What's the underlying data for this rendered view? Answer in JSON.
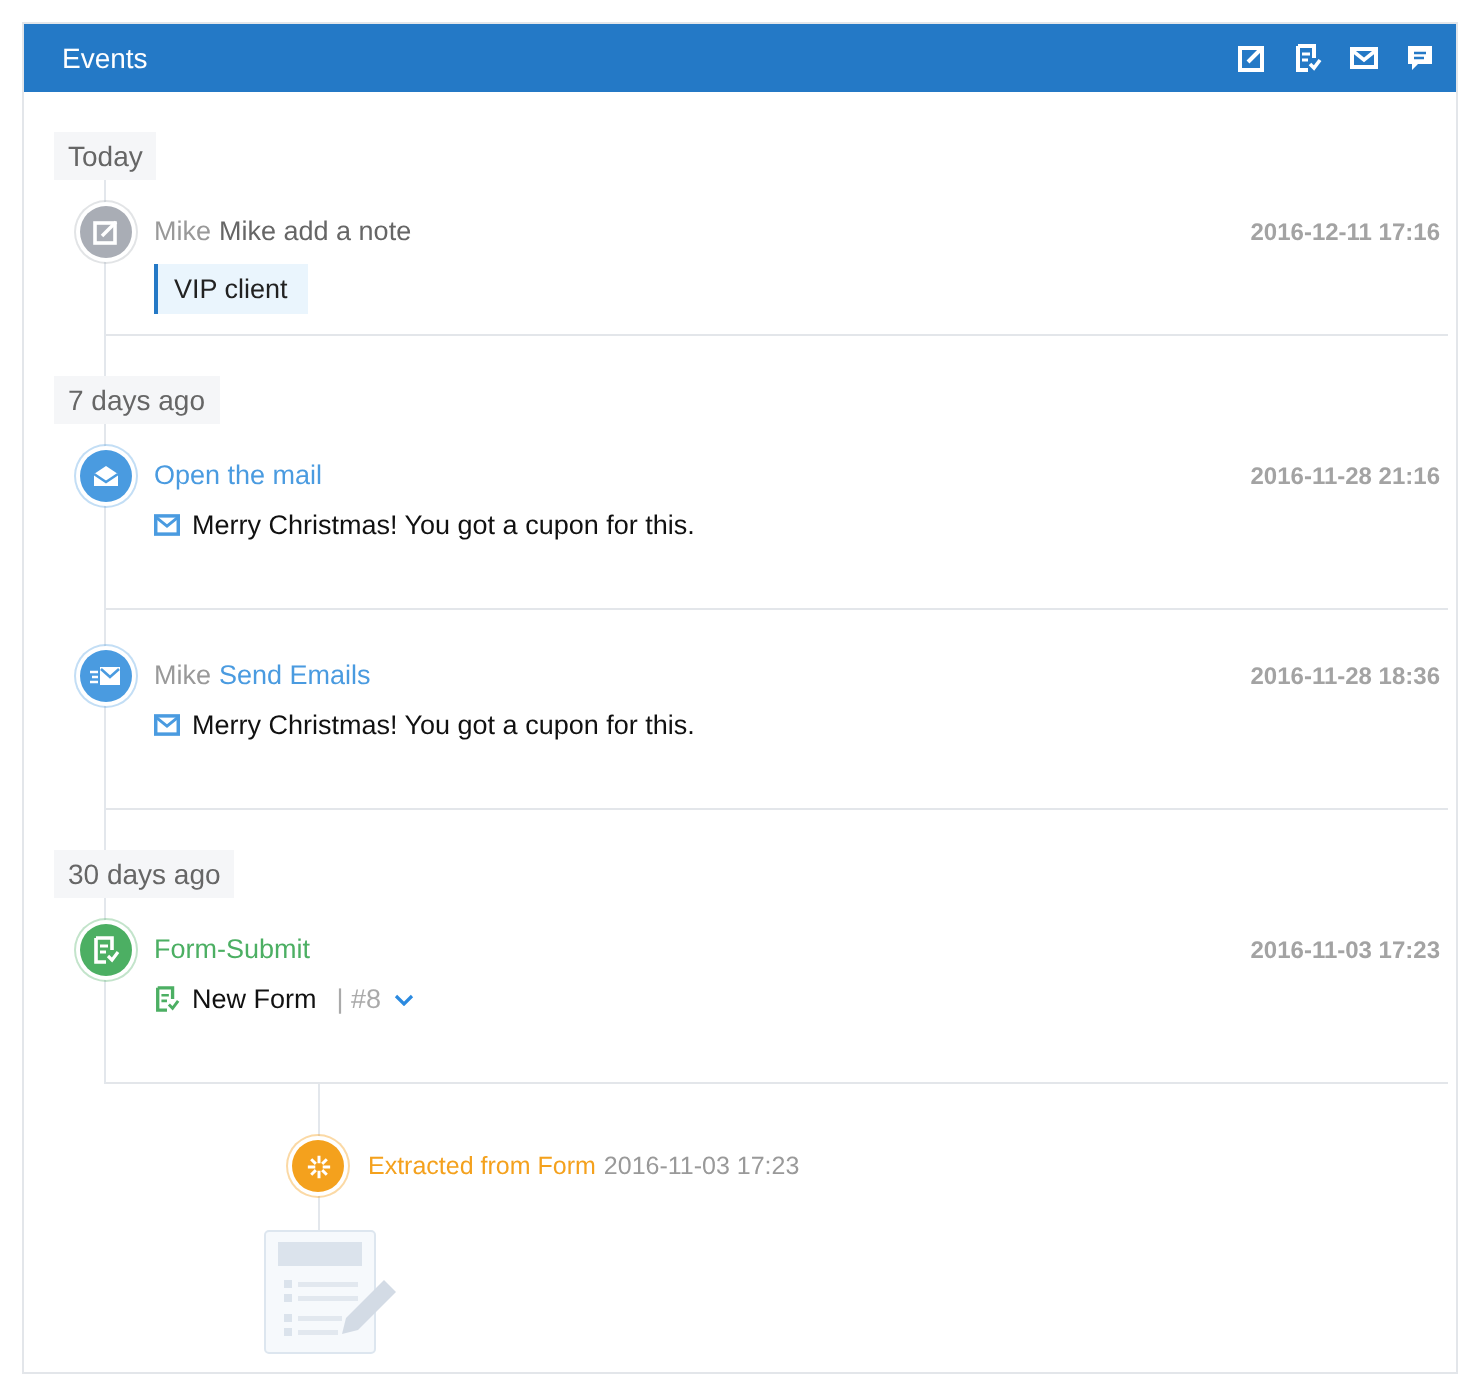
{
  "panel": {
    "title": "Events"
  },
  "groups": [
    {
      "label": "Today",
      "events": [
        {
          "kind": "note",
          "actor": "Mike",
          "title": "Mike add a note",
          "time": "2016-12-11 17:16",
          "note": "VIP client"
        }
      ]
    },
    {
      "label": "7 days ago",
      "events": [
        {
          "kind": "mail-open",
          "title": "Open the mail",
          "time": "2016-11-28 21:16",
          "message": "Merry Christmas! You got a cupon for this."
        },
        {
          "kind": "mail-send",
          "actor": "Mike",
          "title": "Send Emails",
          "time": "2016-11-28 18:36",
          "message": "Merry Christmas! You got a cupon for this."
        }
      ]
    },
    {
      "label": "30 days ago",
      "events": [
        {
          "kind": "form",
          "title": "Form-Submit",
          "time": "2016-11-03 17:23",
          "form": "New Form",
          "number": "| #8"
        }
      ]
    }
  ],
  "sub_event": {
    "title": "Extracted from Form",
    "time": "2016-11-03 17:23"
  }
}
